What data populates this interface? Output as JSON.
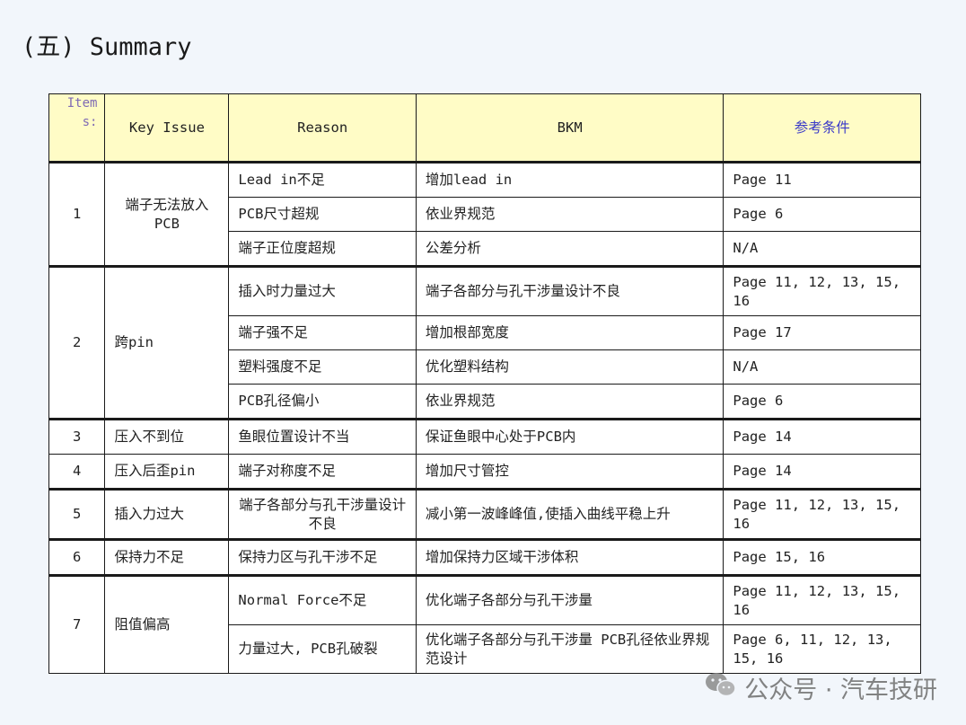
{
  "title": "(五) Summary",
  "table": {
    "headers": {
      "item": "Items:",
      "key_issue": "Key Issue",
      "reason": "Reason",
      "bkm": "BKM",
      "ref": "参考条件"
    },
    "groups": [
      {
        "item": "1",
        "key_issue": "端子无法放入PCB",
        "rows": [
          {
            "reason": "Lead in不足",
            "bkm": "增加lead in",
            "ref": "Page 11"
          },
          {
            "reason": "PCB尺寸超规",
            "bkm": "依业界规范",
            "ref": "Page 6"
          },
          {
            "reason": "端子正位度超规",
            "bkm": "公差分析",
            "ref": "N/A"
          }
        ]
      },
      {
        "item": "2",
        "key_issue": "跨pin",
        "rows": [
          {
            "reason": "插入时力量过大",
            "bkm": "端子各部分与孔干涉量设计不良",
            "ref": "Page 11, 12, 13, 15, 16"
          },
          {
            "reason": "端子强不足",
            "bkm": "增加根部宽度",
            "ref": "Page 17"
          },
          {
            "reason": "塑料强度不足",
            "bkm": "优化塑料结构",
            "ref": "N/A"
          },
          {
            "reason": "PCB孔径偏小",
            "bkm": "依业界规范",
            "ref": "Page 6"
          }
        ]
      },
      {
        "item": "3",
        "key_issue": "压入不到位",
        "rows": [
          {
            "reason": "鱼眼位置设计不当",
            "bkm": "保证鱼眼中心处于PCB内",
            "ref": "Page 14"
          }
        ]
      },
      {
        "item": "4",
        "key_issue": "压入后歪pin",
        "rows": [
          {
            "reason": "端子对称度不足",
            "bkm": "增加尺寸管控",
            "ref": "Page 14"
          }
        ]
      },
      {
        "item": "5",
        "key_issue": "插入力过大",
        "rows": [
          {
            "reason": "端子各部分与孔干涉量设计不良",
            "bkm": "减小第一波峰峰值,使插入曲线平稳上升",
            "ref": "Page 11, 12, 13, 15, 16"
          }
        ]
      },
      {
        "item": "6",
        "key_issue": "保持力不足",
        "rows": [
          {
            "reason": "保持力区与孔干涉不足",
            "bkm": "增加保持力区域干涉体积",
            "ref": "Page 15, 16"
          }
        ]
      },
      {
        "item": "7",
        "key_issue": "阻值偏高",
        "rows": [
          {
            "reason": "Normal Force不足",
            "bkm": "优化端子各部分与孔干涉量",
            "ref": "Page 11, 12, 13, 15, 16"
          },
          {
            "reason": "力量过大, PCB孔破裂",
            "bkm": "优化端子各部分与孔干涉量 PCB孔径依业界规范设计",
            "ref": "Page 6, 11, 12, 13, 15, 16"
          }
        ]
      }
    ]
  },
  "watermark": {
    "text": "公众号 · 汽车技研",
    "icon": "wechat-icon"
  }
}
